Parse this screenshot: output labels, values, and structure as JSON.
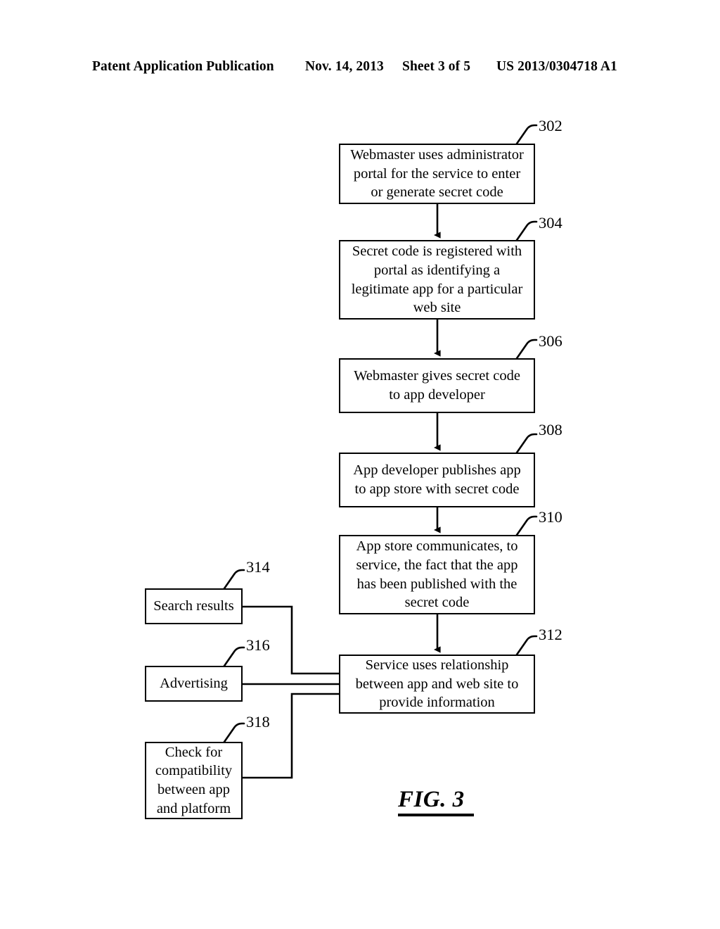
{
  "header": {
    "publication": "Patent Application Publication",
    "date": "Nov. 14, 2013",
    "sheet": "Sheet 3 of 5",
    "patent_number": "US 2013/0304718 A1"
  },
  "figure": {
    "caption": "FIG. 3",
    "boxes": [
      {
        "ref": "302",
        "lines": [
          "Webmaster uses administrator",
          "portal for the service to enter",
          "or generate secret code"
        ]
      },
      {
        "ref": "304",
        "lines": [
          "Secret code is registered with",
          "portal as identifying a",
          "legitimate app for a particular",
          "web site"
        ]
      },
      {
        "ref": "306",
        "lines": [
          "Webmaster gives secret code",
          "to app developer"
        ]
      },
      {
        "ref": "308",
        "lines": [
          "App developer publishes app",
          "to app store with secret code"
        ]
      },
      {
        "ref": "310",
        "lines": [
          "App store communicates, to",
          "service, the fact that the app",
          "has been published with the",
          "secret code"
        ]
      },
      {
        "ref": "312",
        "lines": [
          "Service uses relationship",
          "between app and web site to",
          "provide information"
        ]
      },
      {
        "ref": "314",
        "lines": [
          "Search results"
        ]
      },
      {
        "ref": "316",
        "lines": [
          "Advertising"
        ]
      },
      {
        "ref": "318",
        "lines": [
          "Check for",
          "compatibility",
          "between app",
          "and platform"
        ]
      }
    ]
  }
}
